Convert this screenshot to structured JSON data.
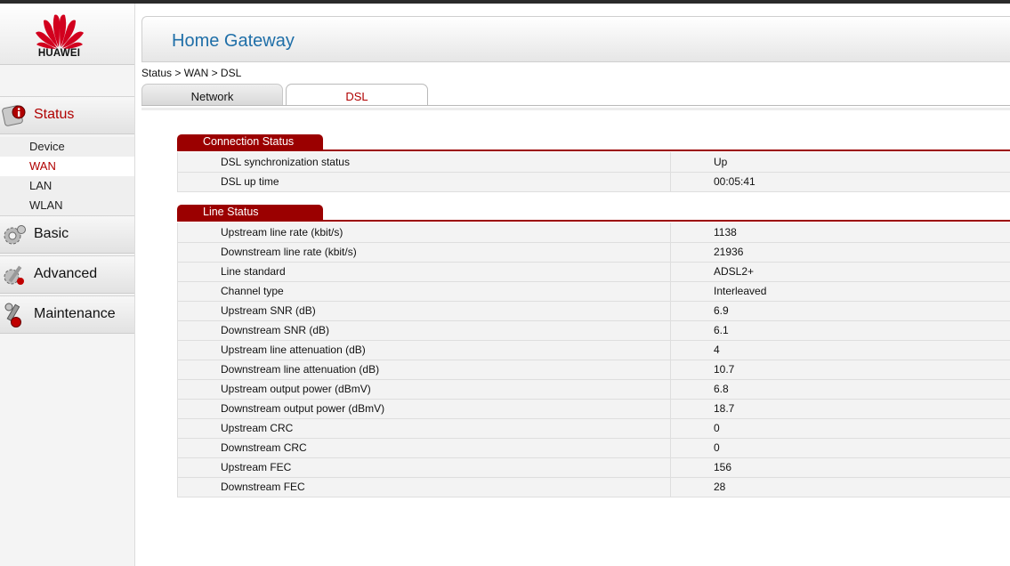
{
  "app": {
    "brand": "HUAWEI",
    "title": "Home Gateway",
    "breadcrumb": "Status > WAN > DSL"
  },
  "sidebar": {
    "status": {
      "label": "Status",
      "items": [
        {
          "label": "Device"
        },
        {
          "label": "WAN"
        },
        {
          "label": "LAN"
        },
        {
          "label": "WLAN"
        }
      ]
    },
    "basic": {
      "label": "Basic"
    },
    "advanced": {
      "label": "Advanced"
    },
    "maintenance": {
      "label": "Maintenance"
    }
  },
  "tabs": [
    {
      "label": "Network"
    },
    {
      "label": "DSL"
    }
  ],
  "connection_status": {
    "title": "Connection Status",
    "rows": [
      {
        "label": "DSL synchronization status",
        "value": "Up"
      },
      {
        "label": "DSL up time",
        "value": "00:05:41"
      }
    ]
  },
  "line_status": {
    "title": "Line Status",
    "rows": [
      {
        "label": "Upstream line rate (kbit/s)",
        "value": "1138"
      },
      {
        "label": "Downstream line rate (kbit/s)",
        "value": "21936"
      },
      {
        "label": "Line standard",
        "value": "ADSL2+"
      },
      {
        "label": "Channel type",
        "value": "Interleaved"
      },
      {
        "label": "Upstream SNR (dB)",
        "value": "6.9"
      },
      {
        "label": "Downstream SNR (dB)",
        "value": "6.1"
      },
      {
        "label": "Upstream line attenuation (dB)",
        "value": "4"
      },
      {
        "label": "Downstream line attenuation (dB)",
        "value": "10.7"
      },
      {
        "label": "Upstream output power (dBmV)",
        "value": "6.8"
      },
      {
        "label": "Downstream output power (dBmV)",
        "value": "18.7"
      },
      {
        "label": "Upstream CRC",
        "value": "0"
      },
      {
        "label": "Downstream CRC",
        "value": "0"
      },
      {
        "label": "Upstream FEC",
        "value": "156"
      },
      {
        "label": "Downstream FEC",
        "value": "28"
      }
    ]
  },
  "colors": {
    "accent": "#9b0000",
    "title_blue": "#1f6fa8",
    "active_text": "#b00000"
  },
  "icons": {
    "logo": "huawei-petal-logo",
    "status": "status-info-icon",
    "basic": "gear-icon",
    "advanced": "advanced-tools-icon",
    "maintenance": "maintenance-wrench-icon"
  }
}
